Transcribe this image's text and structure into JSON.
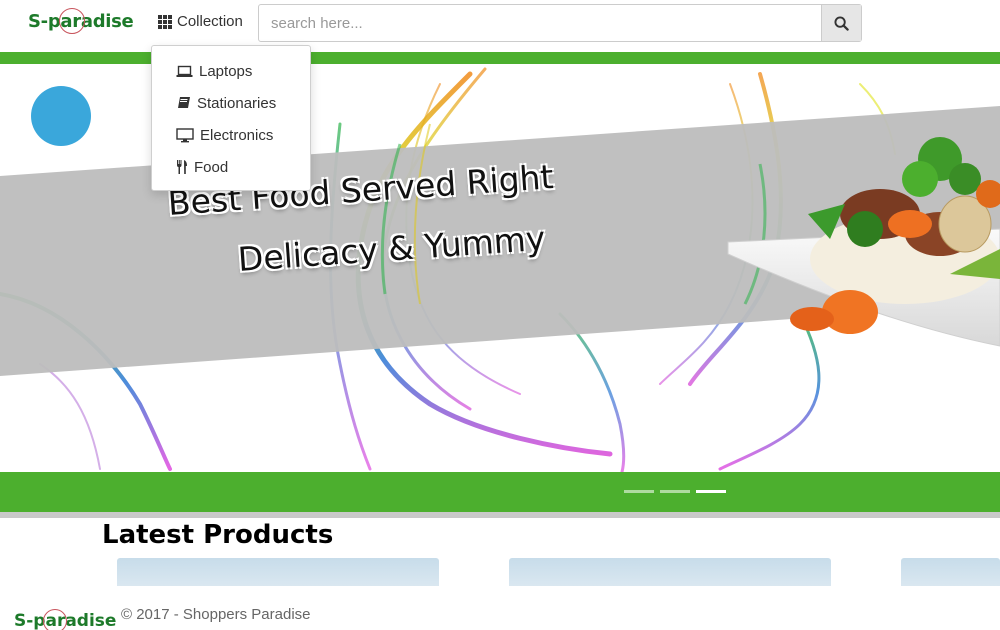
{
  "brand": {
    "name": "S-paradise",
    "color": "#1d7a2a"
  },
  "nav": {
    "collection_label": "Collection",
    "collection_icon": "grid-icon"
  },
  "search": {
    "placeholder": "search here...",
    "value": "",
    "icon": "search-icon"
  },
  "dropdown": {
    "items": [
      {
        "label": "Laptops",
        "icon": "laptop-icon"
      },
      {
        "label": "Stationaries",
        "icon": "book-icon"
      },
      {
        "label": "Electronics",
        "icon": "monitor-icon"
      },
      {
        "label": "Food",
        "icon": "cutlery-icon"
      }
    ]
  },
  "hero": {
    "line1": "Best Food Served Right",
    "line2": "Delicacy & Yummy",
    "slide_count": 3,
    "active_slide": 3,
    "accent_color": "#4caf2e"
  },
  "products": {
    "title": "Latest Products"
  },
  "footer": {
    "logo": "S-paradise",
    "copyright": "© 2017 - Shoppers Paradise"
  }
}
